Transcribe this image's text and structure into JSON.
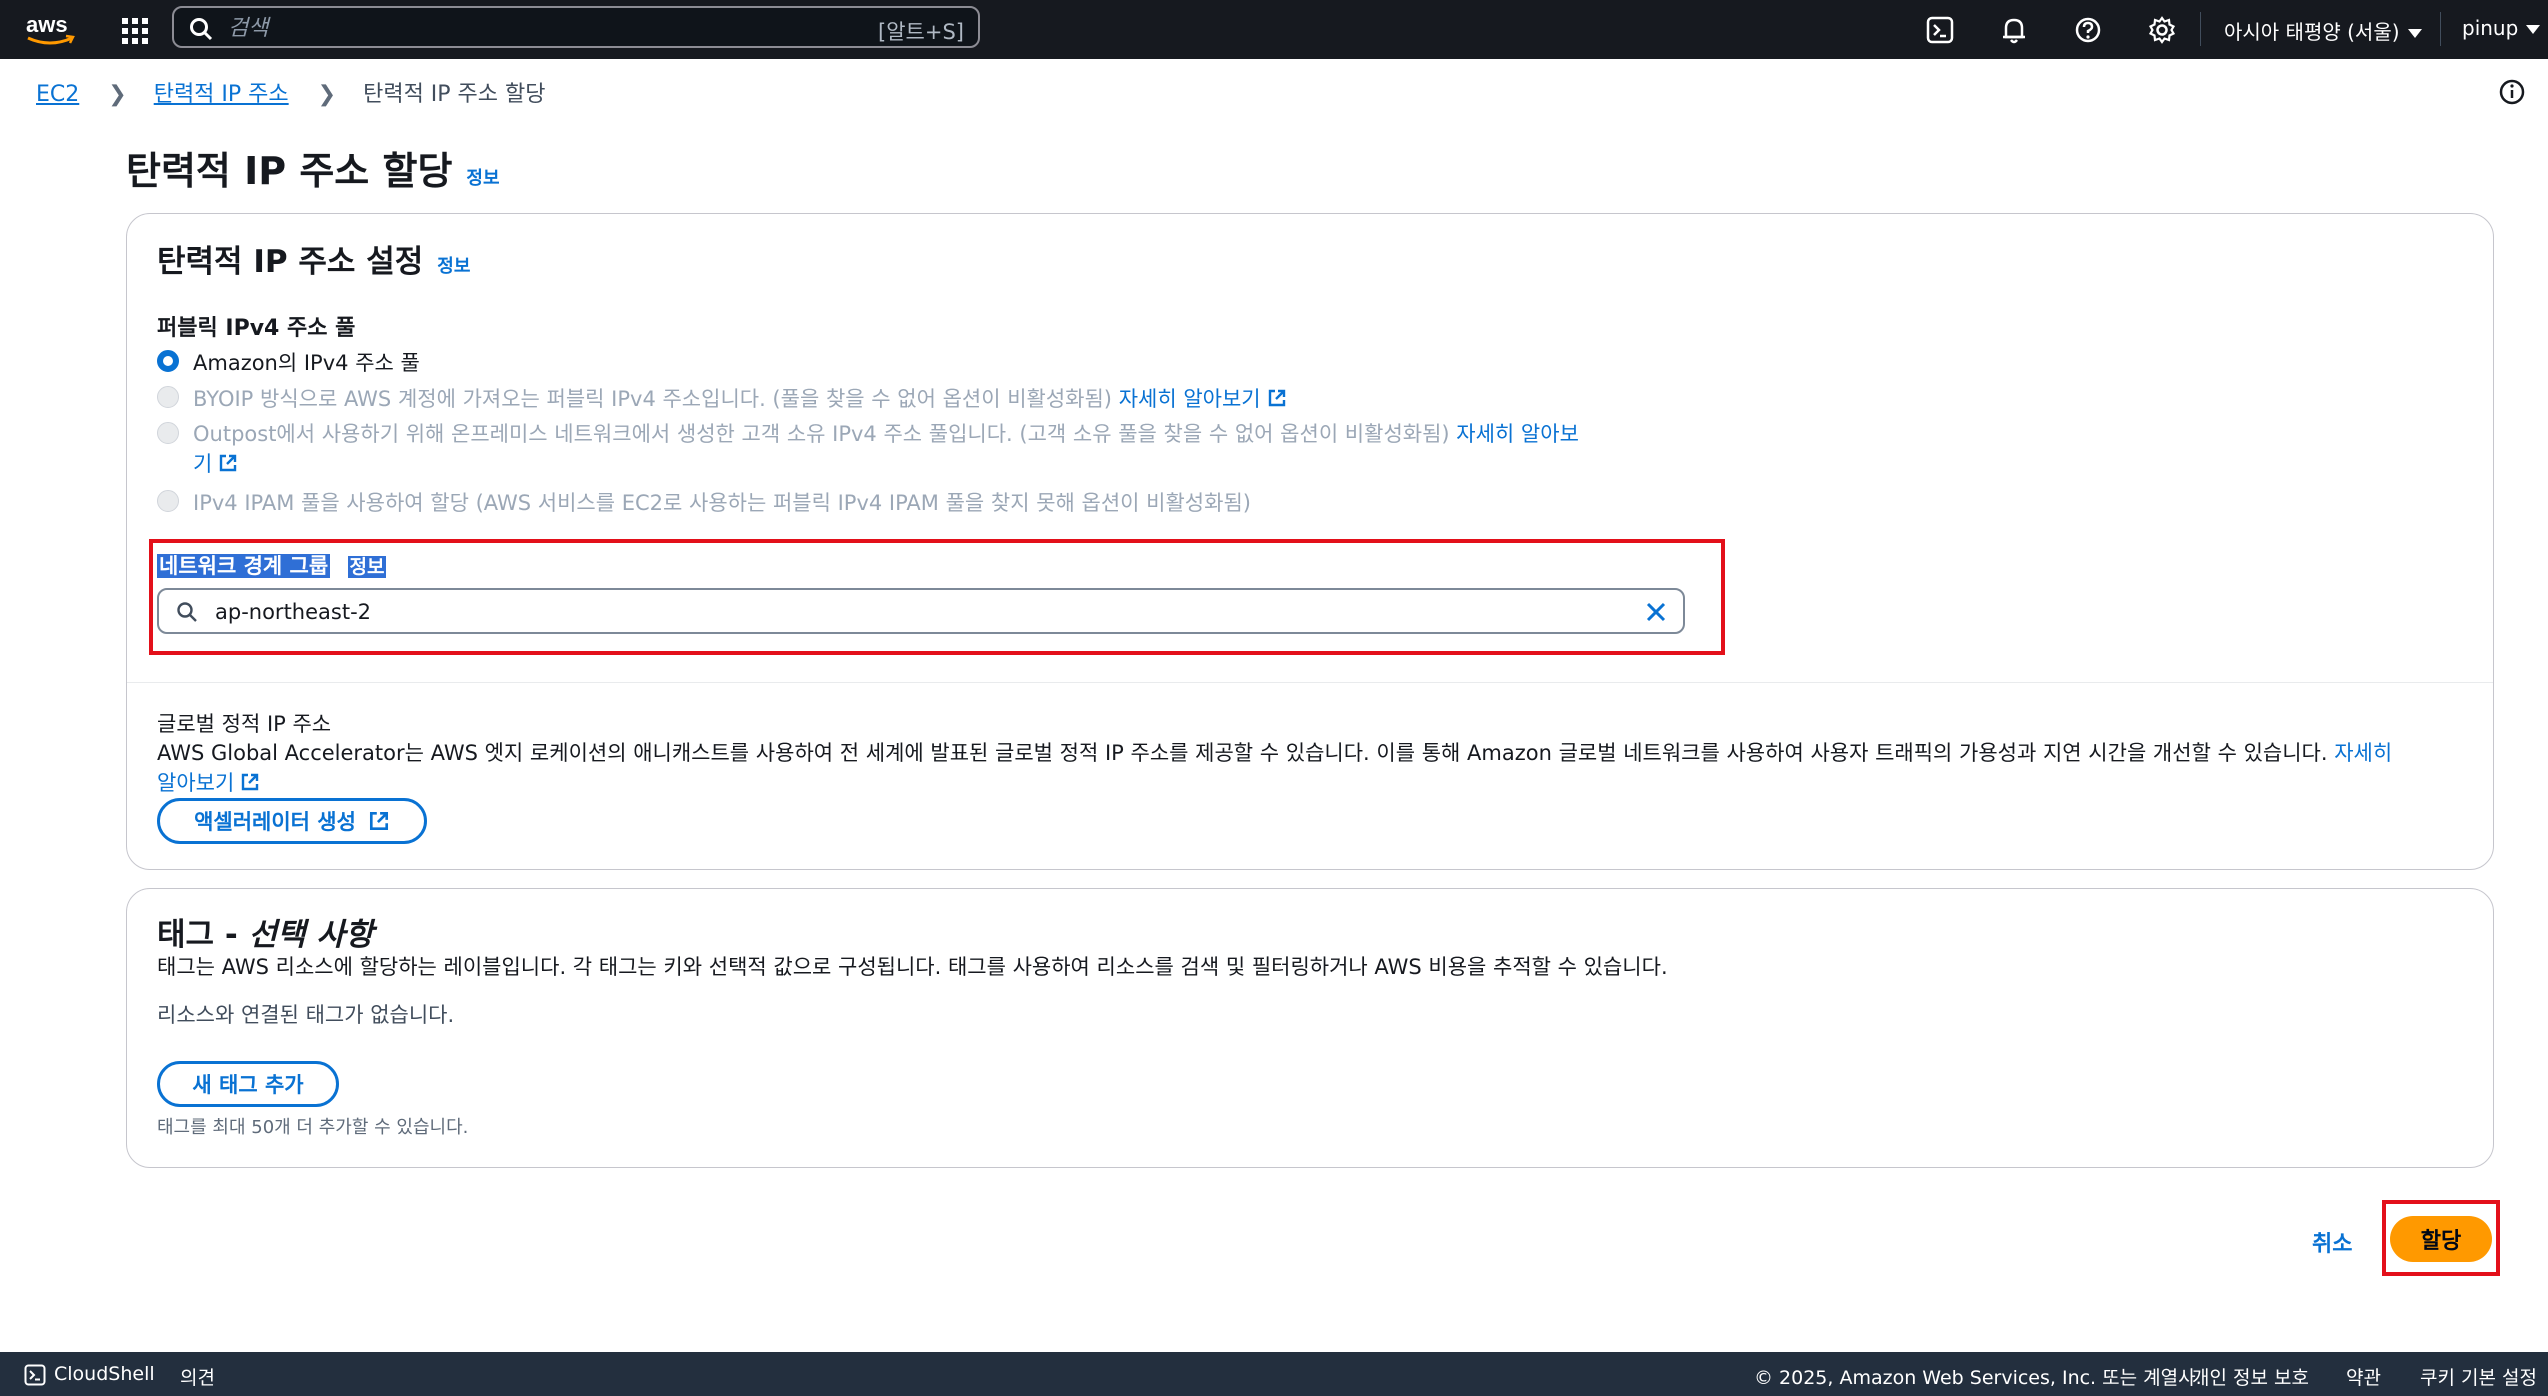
{
  "topnav": {
    "search_placeholder": "검색",
    "search_shortcut": "[알트+S]",
    "region": "아시아 태평양 (서울)",
    "user": "pinup",
    "icons": [
      "aws-logo",
      "services-grid-icon",
      "cloudshell-icon",
      "bell-icon",
      "help-icon",
      "gear-icon"
    ]
  },
  "breadcrumb": {
    "items": [
      "EC2",
      "탄력적 IP 주소"
    ],
    "current": "탄력적 IP 주소 할당"
  },
  "page": {
    "title": "탄력적 IP 주소 할당",
    "info": "정보"
  },
  "settings": {
    "title": "탄력적 IP 주소 설정",
    "info": "정보",
    "pool_label": "퍼블릭 IPv4 주소 풀",
    "options": [
      {
        "label": "Amazon의 IPv4 주소 풀",
        "selected": true,
        "disabled": false
      },
      {
        "label": "BYOIP 방식으로 AWS 계정에 가져오는 퍼블릭 IPv4 주소입니다. (풀을 찾을 수 없어 옵션이 비활성화됨)",
        "link": "자세히 알아보기",
        "disabled": true
      },
      {
        "label": "Outpost에서 사용하기 위해 온프레미스 네트워크에서 생성한 고객 소유 IPv4 주소 풀입니다. (고객 소유 풀을 찾을 수 없어 옵션이 비활성화됨)",
        "link_line1": "자세히 알아보",
        "link_line2": "기",
        "disabled": true
      },
      {
        "label": "IPv4 IPAM 풀을 사용하여 할당 (AWS 서비스를 EC2로 사용하는 퍼블릭 IPv4 IPAM 풀을 찾지 못해 옵션이 비활성화됨)",
        "disabled": true
      }
    ],
    "nbg_label": "네트워크 경계 그룹",
    "nbg_info": "정보",
    "nbg_value": "ap-northeast-2",
    "global_label": "글로벌 정적 IP 주소",
    "global_desc": "AWS Global Accelerator는 AWS 엣지 로케이션의 애니캐스트를 사용하여 전 세계에 발표된 글로벌 정적 IP 주소를 제공할 수 있습니다. 이를 통해 Amazon 글로벌 네트워크를 사용하여 사용자 트래픽의 가용성과 지연 시간을 개선할 수 있습니다.",
    "global_link_line1": "자세히",
    "global_link_line2": "알아보기",
    "accelerator_button": "액셀러레이터 생성"
  },
  "tags": {
    "title_main": "태그 - ",
    "title_italic": "선택 사항",
    "desc": "태그는 AWS 리소스에 할당하는 레이블입니다. 각 태그는 키와 선택적 값으로 구성됩니다. 태그를 사용하여 리소스를 검색 및 필터링하거나 AWS 비용을 추적할 수 있습니다.",
    "empty": "리소스와 연결된 태그가 없습니다.",
    "add_button": "새 태그 추가",
    "limit": "태그를 최대 50개 더 추가할 수 있습니다."
  },
  "actions": {
    "cancel": "취소",
    "allocate": "할당"
  },
  "footer": {
    "cloudshell": "CloudShell",
    "feedback": "의견",
    "copyright": "© 2025, Amazon Web Services, Inc. 또는 계열사.",
    "privacy": "개인 정보 보호",
    "terms": "약관",
    "cookies": "쿠키 기본 설정"
  },
  "colors": {
    "nav_bg": "#16191f",
    "link": "#0972d3",
    "primary_button": "#ff9900",
    "highlight_box": "#e3101a"
  }
}
